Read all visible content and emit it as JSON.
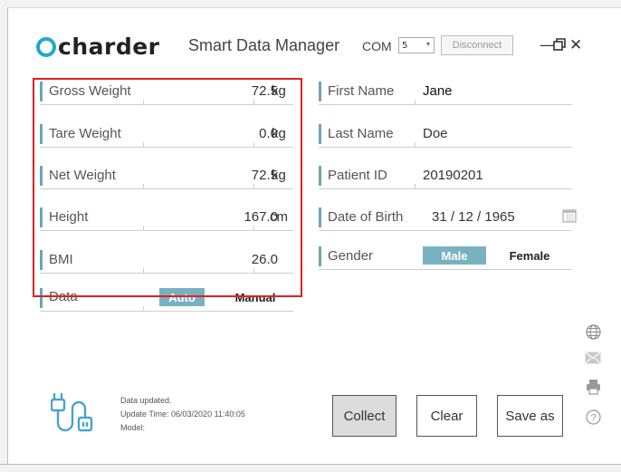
{
  "header": {
    "logo_mark": "O",
    "logo_text": "charder",
    "app_title": "Smart Data Manager",
    "com_label": "COM",
    "com_value": "5",
    "disconnect_label": "Disconnect",
    "minimize": "—",
    "restore": "⧉",
    "close": "✕"
  },
  "measurements": [
    {
      "label": "Gross Weight",
      "value": "72.5",
      "unit": "kg"
    },
    {
      "label": "Tare Weight",
      "value": "0.0",
      "unit": "kg"
    },
    {
      "label": "Net Weight",
      "value": "72.5",
      "unit": "kg"
    },
    {
      "label": "Height",
      "value": "167.0",
      "unit": "cm"
    },
    {
      "label": "BMI",
      "value": "26.0",
      "unit": ""
    }
  ],
  "data_mode": {
    "label": "Data",
    "auto_label": "Auto",
    "manual_label": "Manual",
    "selected": "Auto"
  },
  "patient": {
    "first_name_label": "First Name",
    "first_name": "Jane",
    "last_name_label": "Last Name",
    "last_name": "Doe",
    "patient_id_label": "Patient ID",
    "patient_id": "20190201",
    "dob_label": "Date of Birth",
    "dob": "31 / 12 / 1965",
    "gender_label": "Gender",
    "male_label": "Male",
    "female_label": "Female",
    "gender_selected": "Male"
  },
  "status": {
    "line1": "Data updated.",
    "line2": "Update Time: 06/03/2020 11:40:05",
    "line3": "Model:"
  },
  "buttons": {
    "collect": "Collect",
    "clear": "Clear",
    "save_as": "Save as"
  },
  "side_icons": [
    "globe-icon",
    "mail-icon",
    "printer-icon",
    "help-icon"
  ],
  "colors": {
    "accent": "#78b1c1",
    "logo_ring": "#1fa8d0",
    "highlight_box": "#e02020"
  }
}
